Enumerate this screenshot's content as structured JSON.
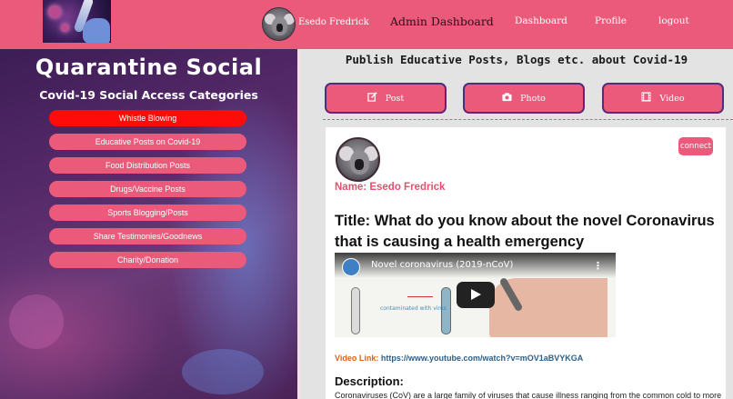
{
  "header": {
    "user_name": "Esedo Fredrick",
    "admin_label": "Admin Dashboard",
    "nav": [
      "Dashboard",
      "Profile",
      "logout"
    ],
    "brand_color": "#ec5a7b"
  },
  "sidebar": {
    "title": "Quarantine Social",
    "subtitle": "Covid-19 Social Access Categories",
    "categories": [
      {
        "label": "Whistle Blowing",
        "active": true
      },
      {
        "label": "Educative Posts on Covid-19",
        "active": false
      },
      {
        "label": "Food Distribution Posts",
        "active": false
      },
      {
        "label": "Drugs/Vaccine Posts",
        "active": false
      },
      {
        "label": "Sports Blogging/Posts",
        "active": false
      },
      {
        "label": "Share Testimonies/Goodnews",
        "active": false
      },
      {
        "label": "Charity/Donation",
        "active": false
      }
    ],
    "active_color": "#ff0b0b"
  },
  "main": {
    "publish_heading": "Publish Educative Posts, Blogs etc. about Covid-19",
    "post_buttons": [
      {
        "label": "Post",
        "icon": "edit-icon"
      },
      {
        "label": "Photo",
        "icon": "camera-icon"
      },
      {
        "label": "Video",
        "icon": "film-icon"
      }
    ]
  },
  "post": {
    "connect_label": "connect",
    "name_text": "Name: Esedo Fredrick",
    "title": "Title: What do you know about the novel Coronavirus that is causing a health emergency",
    "video_title": "Novel coronavirus (2019-nCoV)",
    "video_handwriting": "contaminated with virus",
    "video_link_label": "Video Link:",
    "video_link": "https://www.youtube.com/watch?v=mOV1aBVYKGA",
    "description_heading": "Description:",
    "description": "Coronaviruses (CoV) are a large family of viruses that cause illness ranging from the common cold to more"
  }
}
